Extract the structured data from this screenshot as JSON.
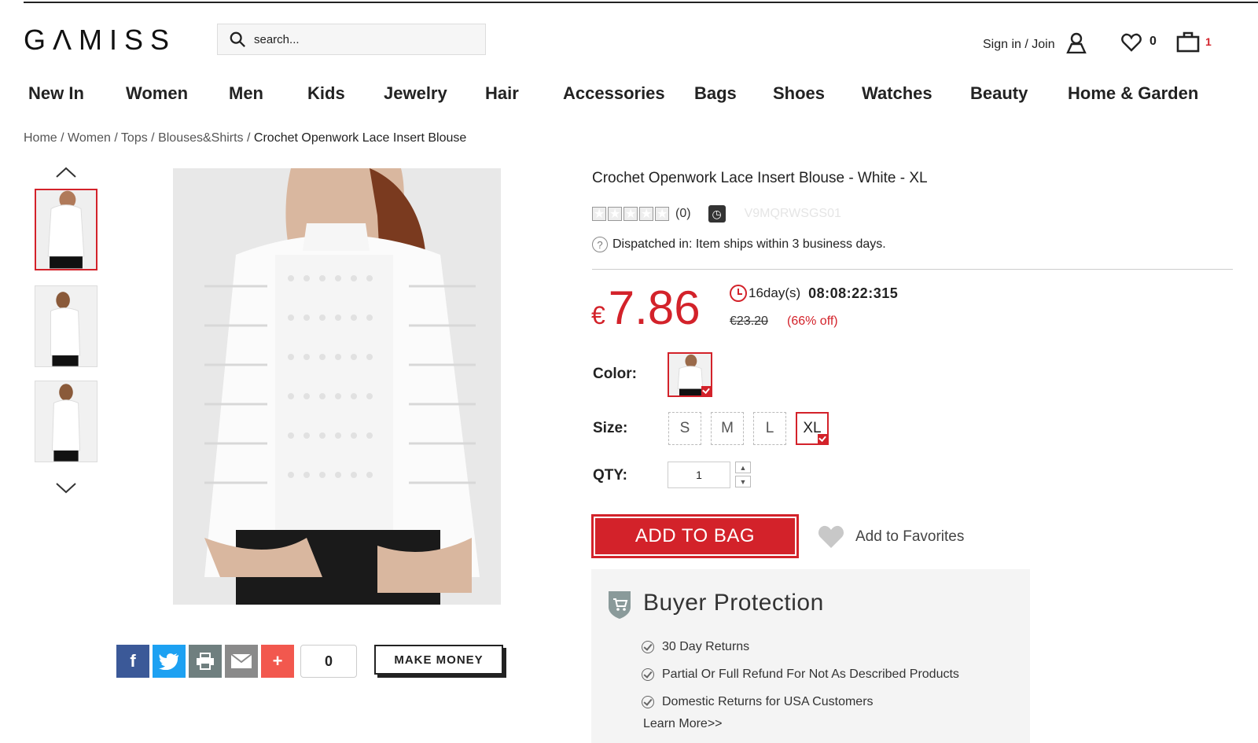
{
  "header": {
    "logo": "GΛMISS",
    "search_placeholder": "search...",
    "signin": "Sign in / Join",
    "favorites_count": "0",
    "bag_count": "1"
  },
  "nav": [
    "New In",
    "Women",
    "Men",
    "Kids",
    "Jewelry",
    "Hair",
    "Accessories",
    "Bags",
    "Shoes",
    "Watches",
    "Beauty",
    "Home & Garden"
  ],
  "breadcrumb": [
    "Home",
    "Women",
    "Tops",
    "Blouses&Shirts",
    "Crochet Openwork Lace Insert Blouse"
  ],
  "product": {
    "title": "Crochet Openwork Lace Insert Blouse - White - XL",
    "rating_count": "(0)",
    "sku": "V9MQRWSGS01",
    "dispatch": "Dispatched in: Item ships within 3 business days.",
    "currency": "€",
    "price": "7.86",
    "countdown_days": "16day(s)",
    "countdown_time": "08:08:22:315",
    "old_price": "€23.20",
    "discount": "(66% off)",
    "color_label": "Color:",
    "size_label": "Size:",
    "sizes": [
      "S",
      "M",
      "L",
      "XL"
    ],
    "selected_size": "XL",
    "qty_label": "QTY:",
    "qty": "1",
    "add_to_bag": "ADD TO BAG",
    "add_to_favorites": "Add to Favorites"
  },
  "share": {
    "count": "0",
    "make_money": "MAKE MONEY"
  },
  "buyer_protection": {
    "title": "Buyer Protection",
    "items": [
      "30 Day Returns",
      "Partial Or Full Refund For Not As Described Products",
      "Domestic Returns for USA Customers"
    ],
    "learn_more": "Learn More>>"
  },
  "colors": {
    "accent": "#d3222a",
    "facebook": "#3b5998",
    "twitter": "#1da1f2",
    "print": "#6f7f7f",
    "email": "#8a8a8a",
    "plus": "#f2584e"
  }
}
